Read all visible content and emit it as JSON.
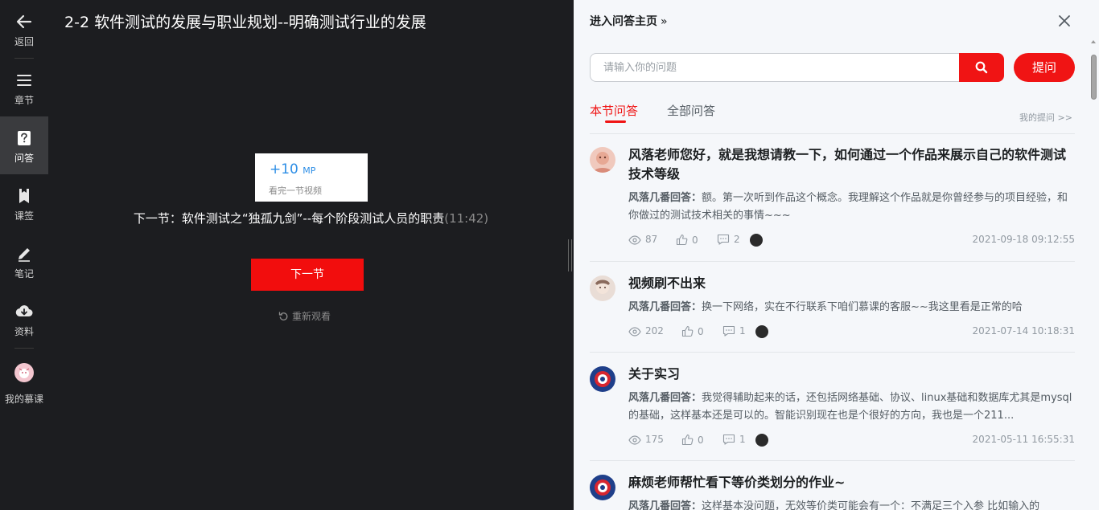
{
  "sidebar": {
    "items": [
      {
        "label": "返回",
        "icon": "back-arrow-icon"
      },
      {
        "label": "章节",
        "icon": "menu-lines-icon"
      },
      {
        "label": "问答",
        "icon": "question-icon",
        "active": true
      },
      {
        "label": "课签",
        "icon": "bookmark-icon"
      },
      {
        "label": "笔记",
        "icon": "pencil-icon"
      },
      {
        "label": "资料",
        "icon": "cloud-download-icon"
      },
      {
        "label": "我的慕课",
        "icon": "user-avatar"
      }
    ]
  },
  "player": {
    "title": "2-2 软件测试的发展与职业规划--明确测试行业的发展",
    "reward": {
      "value": "+10",
      "unit": "MP",
      "caption": "看完一节视频"
    },
    "next_prefix": "下一节：软件测试之“独孤九剑”--每个阶段测试人员的职责",
    "next_duration": "(11:42)",
    "next_button": "下一节",
    "rewatch": "重新观看"
  },
  "qa": {
    "home_link": "进入问答主页",
    "home_chevron": "»",
    "search_placeholder": "请输入你的问题",
    "ask_button": "提问",
    "tabs": [
      "本节问答",
      "全部问答"
    ],
    "my_questions": "我的提问 >>",
    "items": [
      {
        "title": "风落老师您好，就是我想请教一下，如何通过一个作品来展示自己的软件测试技术等级",
        "answerer": "风落几番回答：",
        "answer": "额。第一次听到作品这个概念。我理解这个作品就是你曾经参与的项目经验，和你做过的测试技术相关的事情~~~",
        "views": "87",
        "likes": "0",
        "comments": "2",
        "time": "2021-09-18 09:12:55"
      },
      {
        "title": "视频刷不出来",
        "answerer": "风落几番回答：",
        "answer": "换一下网络，实在不行联系下咱们慕课的客服~~我这里看是正常的哈",
        "views": "202",
        "likes": "0",
        "comments": "1",
        "time": "2021-07-14 10:18:31"
      },
      {
        "title": "关于实习",
        "answerer": "风落几番回答：",
        "answer": "我觉得辅助起来的话，还包括网络基础、协议、linux基础和数据库尤其是mysql的基础，这样基本还是可以的。智能识别现在也是个很好的方向，我也是一个211...",
        "views": "175",
        "likes": "0",
        "comments": "1",
        "time": "2021-05-11 16:55:31"
      },
      {
        "title": "麻烦老师帮忙看下等价类划分的作业~",
        "answerer": "风落几番回答：",
        "answer": "这样基本没问题，无效等价类可能会有一个：不满足三个入参 比如输入的"
      }
    ]
  },
  "colors": {
    "accent": "#f01414",
    "sidebar_bg": "#1c1d20",
    "sidebar_active": "#3a3b3e",
    "panel_bg": "#f5f7fa",
    "mp_blue": "#2d8ee6"
  }
}
